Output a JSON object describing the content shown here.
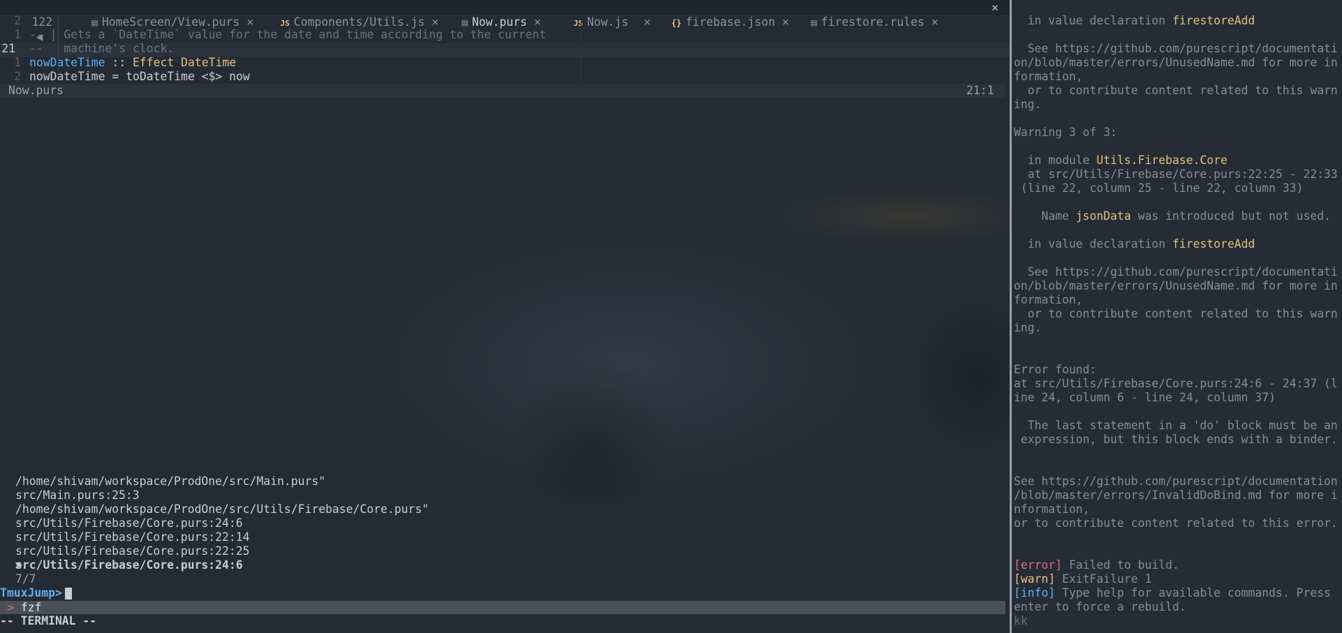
{
  "tabbar": {
    "count": "122",
    "tabs": [
      {
        "label": "HomeScreen/View.purs",
        "icon": "doc"
      },
      {
        "label": "Components/Utils.js",
        "icon": "JS"
      },
      {
        "label": "Now.purs",
        "icon": "doc"
      },
      {
        "label": "Now.js",
        "icon": "JS"
      },
      {
        "label": "firebase.json",
        "icon": "{}"
      },
      {
        "label": "firestore.rules",
        "icon": "doc"
      }
    ],
    "close_glyph": "×",
    "close_all_glyph": "✕"
  },
  "editor": {
    "lines": [
      {
        "num": "2",
        "text": ""
      },
      {
        "num": "1",
        "text": "-- | Gets a `DateTime` value for the date and time according to the current"
      },
      {
        "num": "21",
        "text": "--   machine's clock."
      },
      {
        "num": "1",
        "code": [
          "nowDateTime",
          " :: ",
          "Effect DateTime"
        ]
      },
      {
        "num": "2",
        "text": "nowDateTime = toDateTime <$> now"
      }
    ],
    "status": {
      "filename": "Now.purs",
      "position": "21:1"
    }
  },
  "terminal": {
    "lines": [
      "/home/shivam/workspace/ProdOne/src/Main.purs\"",
      "src/Main.purs:25:3",
      "/home/shivam/workspace/ProdOne/src/Utils/Firebase/Core.purs\"",
      "src/Utils/Firebase/Core.purs:24:6",
      "src/Utils/Firebase/Core.purs:22:14",
      "src/Utils/Firebase/Core.purs:22:25"
    ],
    "selected": "src/Utils/Firebase/Core.purs:24:6",
    "pointer": ">",
    "count": "7/7",
    "prompt": "TmuxJump>",
    "fzf_label": "fzf",
    "fzf_chevron": ">",
    "mode": "-- TERMINAL --"
  },
  "right_pane": {
    "l1_pre": "  in value declaration ",
    "l1_hl": "firestoreAdd",
    "l2": "  See https://github.com/purescript/documentati",
    "l3": "on/blob/master/errors/UnusedName.md for more in",
    "l4": "formation,",
    "l5": "  or to contribute content related to this warn",
    "l6": "ing.",
    "l7": "Warning 3 of 3:",
    "l8_pre": "  in module ",
    "l8_hl": "Utils.Firebase.Core",
    "l9": "  at src/Utils/Firebase/Core.purs:22:25 - 22:33",
    "l10": " (line 22, column 25 - line 22, column 33)",
    "l11_pre": "    Name ",
    "l11_hl": "jsonData",
    "l11_post": " was introduced but not used.",
    "l12_pre": "  in value declaration ",
    "l12_hl": "firestoreAdd",
    "l13": "  See https://github.com/purescript/documentati",
    "l14": "on/blob/master/errors/UnusedName.md for more in",
    "l15": "formation,",
    "l16": "  or to contribute content related to this warn",
    "l17": "ing.",
    "l18": "Error found:",
    "l19": "at src/Utils/Firebase/Core.purs:24:6 - 24:37 (l",
    "l20": "ine 24, column 6 - line 24, column 37)",
    "l21": "  The last statement in a 'do' block must be an",
    "l22": " expression, but this block ends with a binder.",
    "l23": "See https://github.com/purescript/documentation",
    "l24": "/blob/master/errors/InvalidDoBind.md for more i",
    "l25": "nformation,",
    "l26": "or to contribute content related to this error.",
    "l27_tag": "[error]",
    "l27_text": " Failed to build.",
    "l28_tag": "[warn]",
    "l28_text": " ExitFailure 1",
    "l29_tag": "[info]",
    "l29_text": " Type help for available commands. Press",
    "l30": "enter to force a rebuild.",
    "l31": "kk"
  },
  "colors": {
    "background": "#242b35",
    "keyword_blue": "#61afef",
    "type_yellow": "#e5c07b",
    "error_red": "#e06c75"
  }
}
